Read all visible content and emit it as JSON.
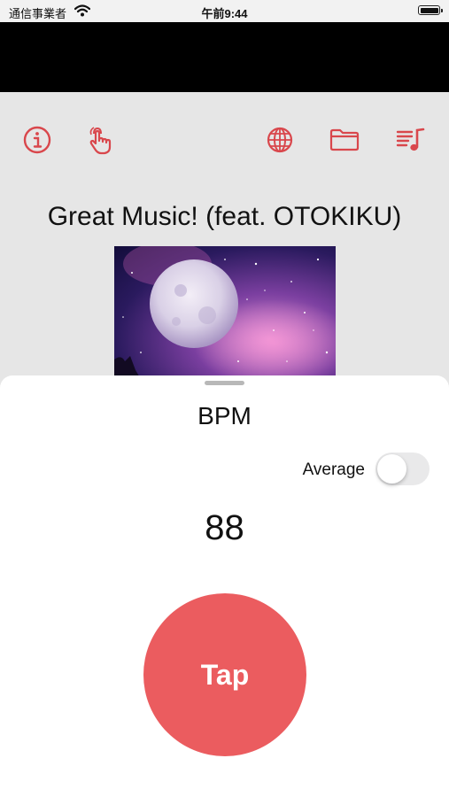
{
  "status_bar": {
    "carrier": "通信事業者",
    "time": "午前9:44",
    "icons": [
      "wifi-icon",
      "battery-icon"
    ]
  },
  "toolbar": {
    "accent_color": "#d9474c",
    "icons": [
      "info-icon",
      "tap-hand-icon",
      "globe-icon",
      "folder-icon",
      "playlist-icon"
    ]
  },
  "player": {
    "title": "Great Music! (feat. OTOKIKU)"
  },
  "bpm_sheet": {
    "title": "BPM",
    "average_label": "Average",
    "average_enabled": false,
    "bpm_value": "88",
    "tap_label": "Tap",
    "tap_color": "#eb5c5f"
  }
}
